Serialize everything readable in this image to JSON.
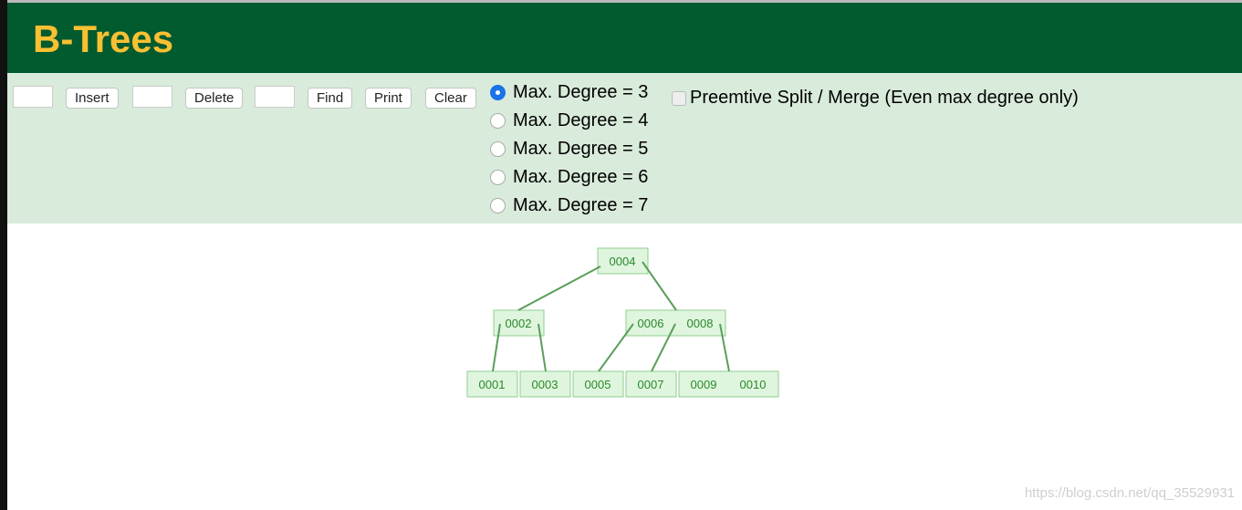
{
  "header": {
    "title": "B-Trees"
  },
  "toolbar": {
    "insert_label": "Insert",
    "delete_label": "Delete",
    "find_label": "Find",
    "print_label": "Print",
    "clear_label": "Clear",
    "insert_value": "",
    "delete_value": "",
    "find_value": "",
    "degrees": [
      {
        "label": "Max. Degree = 3",
        "selected": true
      },
      {
        "label": "Max. Degree = 4",
        "selected": false
      },
      {
        "label": "Max. Degree = 5",
        "selected": false
      },
      {
        "label": "Max. Degree = 6",
        "selected": false
      },
      {
        "label": "Max. Degree = 7",
        "selected": false
      }
    ],
    "preemptive_label": "Preemtive Split / Merge (Even max degree only)",
    "preemptive_checked": false
  },
  "tree": {
    "nodes": [
      [
        "0004"
      ],
      [
        "0002"
      ],
      [
        "0006",
        "0008"
      ],
      [
        "0001"
      ],
      [
        "0003"
      ],
      [
        "0005"
      ],
      [
        "0007"
      ],
      [
        "0009",
        "0010"
      ]
    ],
    "edges": [
      [
        0,
        1
      ],
      [
        0,
        2
      ],
      [
        1,
        3
      ],
      [
        1,
        4
      ],
      [
        2,
        5
      ],
      [
        2,
        6
      ],
      [
        2,
        7
      ]
    ],
    "colors": {
      "fill": "#dff5de",
      "stroke": "#8fcf8f",
      "text": "#2a8a2a",
      "edge": "#5a9e5a"
    }
  },
  "watermark": "https://blog.csdn.net/qq_35529931"
}
